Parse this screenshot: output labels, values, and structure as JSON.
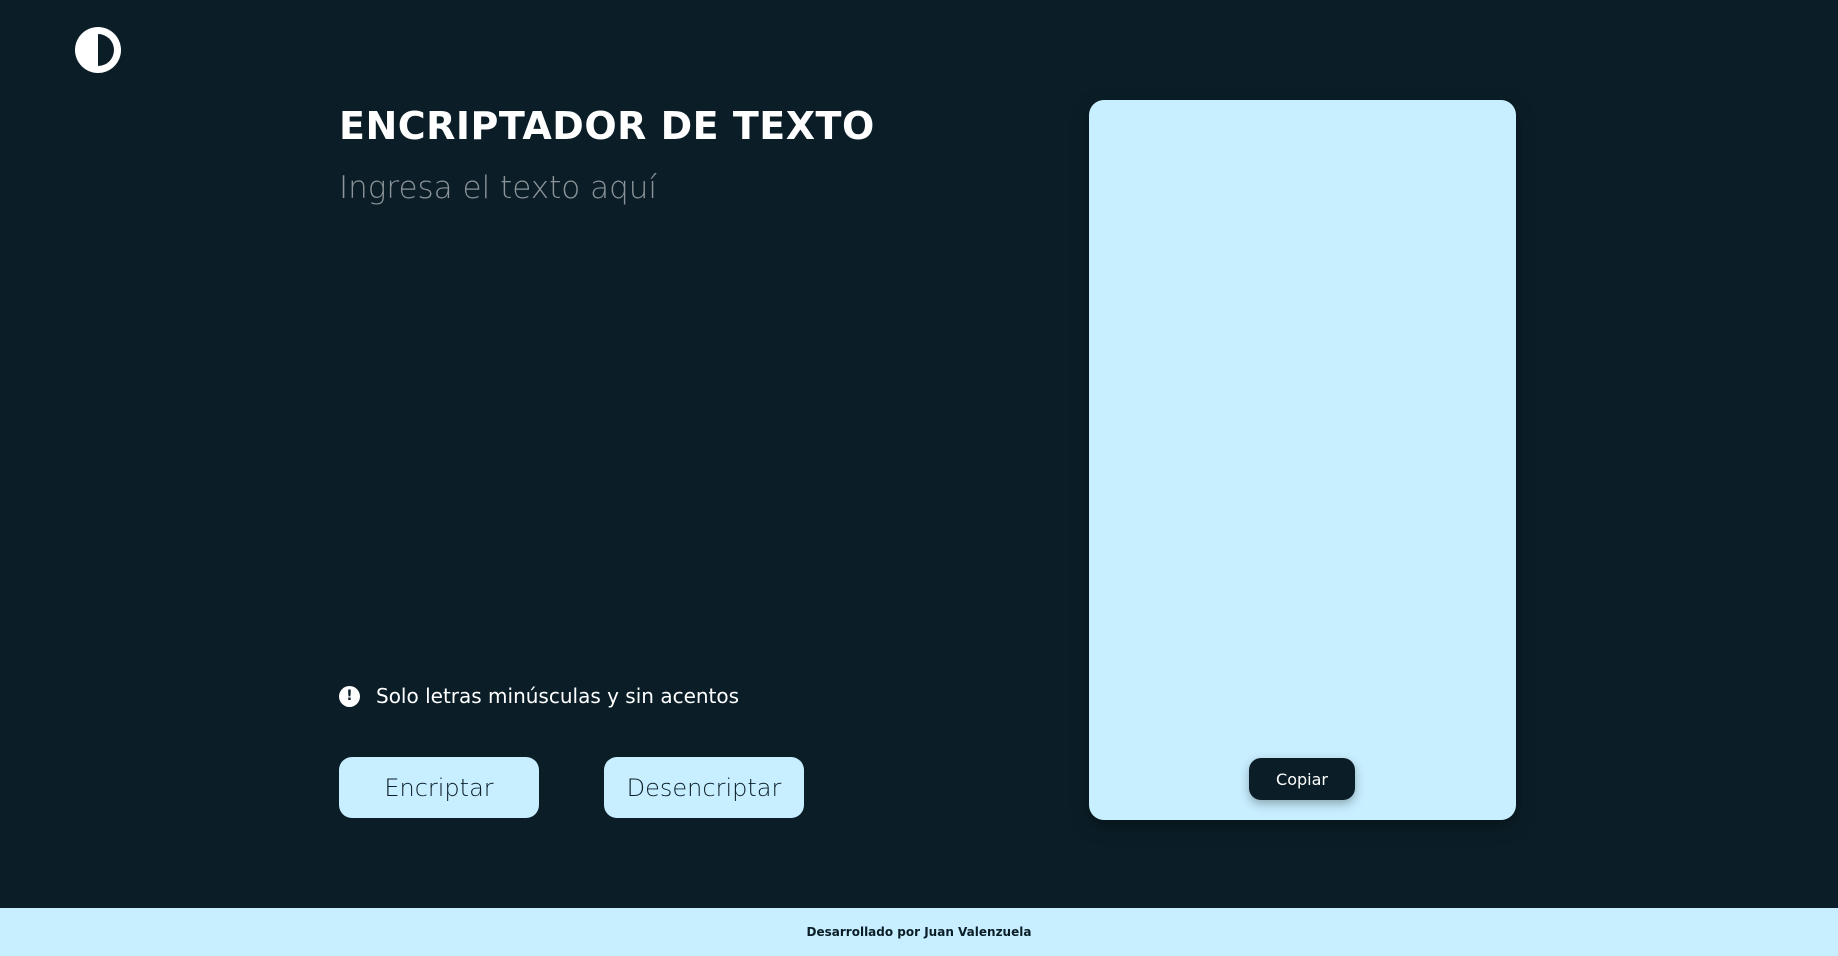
{
  "header": {
    "logo_icon": "contrast-half-circle-icon",
    "title": "ENCRIPTADOR DE TEXTO"
  },
  "input": {
    "value": "",
    "placeholder": "Ingresa el texto aquí"
  },
  "warning": {
    "icon": "exclamation-circle-icon",
    "text": "Solo letras minúsculas y sin acentos"
  },
  "buttons": {
    "encrypt_label": "Encriptar",
    "decrypt_label": "Desencriptar"
  },
  "output": {
    "copy_label": "Copiar"
  },
  "footer": {
    "text": "Desarrollado por Juan Valenzuela"
  },
  "colors": {
    "background": "#0b1e27",
    "accent": "#c8efff",
    "text": "#ffffff"
  }
}
